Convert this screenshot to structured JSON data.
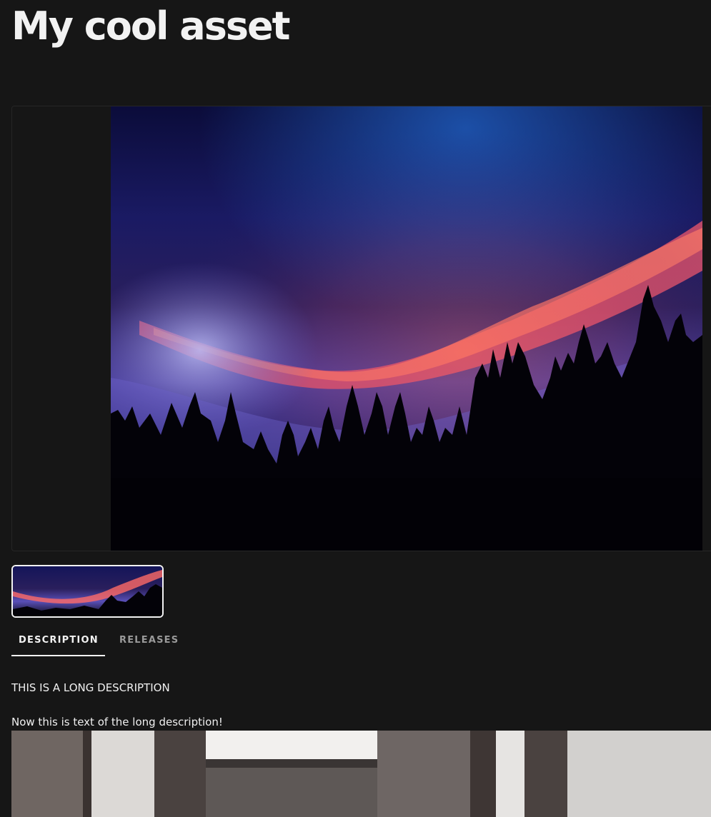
{
  "page": {
    "title": "My cool asset"
  },
  "tabs": [
    {
      "label": "DESCRIPTION",
      "active": true
    },
    {
      "label": "RELEASES",
      "active": false
    }
  ],
  "description": {
    "heading": "THIS IS A LONG DESCRIPTION",
    "body": "Now this is text of the long description!"
  },
  "colors": {
    "background": "#161616",
    "text": "#f2f2f2",
    "tab_inactive": "#9a9a9a"
  }
}
